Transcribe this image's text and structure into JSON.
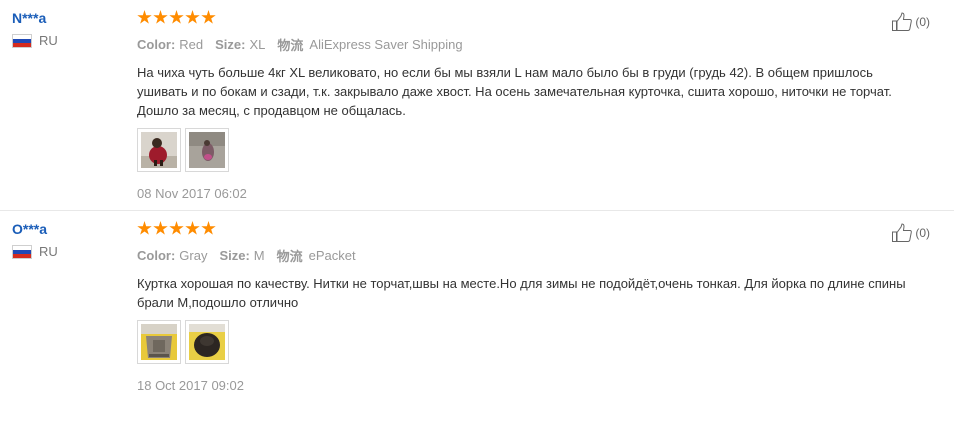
{
  "reviews": [
    {
      "user": "N***a",
      "country": "RU",
      "rating_stars": 5,
      "color_label": "Color:",
      "color_value": "Red",
      "size_label": "Size:",
      "size_value": "XL",
      "shipping_label": "物流",
      "shipping_value": "AliExpress Saver Shipping",
      "text": "На чиха чуть больше 4кг XL великовато, но если бы мы взяли L нам мало было бы в груди (грудь 42). В общем пришлось ушивать и по бокам и сзади, т.к. закрывало даже хвост. На осень замечательная курточка, сшита хорошо, ниточки не торчат. Дошло за месяц, с продавцом не общалась.",
      "date": "08 Nov 2017 06:02",
      "helpful_count": "(0)",
      "photos": [
        "dog-in-red-jacket-photo",
        "dog-on-floor-photo"
      ]
    },
    {
      "user": "O***a",
      "country": "RU",
      "rating_stars": 5,
      "color_label": "Color:",
      "color_value": "Gray",
      "size_label": "Size:",
      "size_value": "M",
      "shipping_label": "物流",
      "shipping_value": "ePacket",
      "text": "Куртка хорошая по качеству. Нитки не торчат,швы на месте.Но для зимы не подойдёт,очень тонкая. Для йорка по длине спины брали М,подошло отлично",
      "date": "18 Oct 2017 09:02",
      "helpful_count": "(0)",
      "photos": [
        "gray-jacket-photo",
        "dog-in-dark-jacket-photo"
      ]
    }
  ],
  "colors": {
    "star": "#ff8c00",
    "username": "#1a5db8"
  }
}
